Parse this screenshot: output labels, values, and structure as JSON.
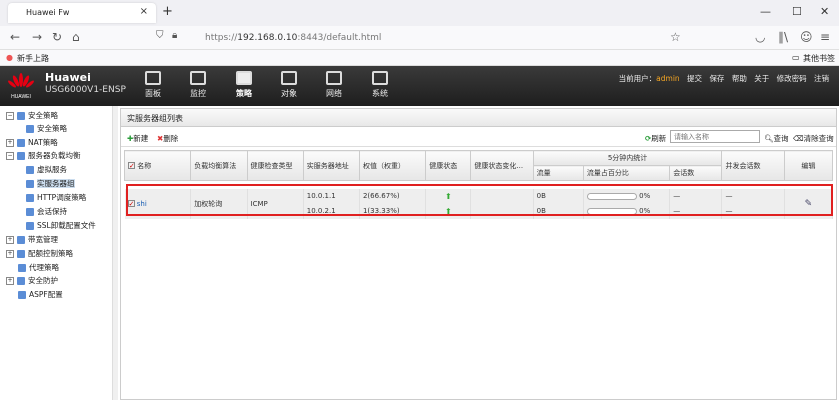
{
  "browser": {
    "tab_title": "Huawei Fw",
    "tab_close": "×",
    "new_tab": "+",
    "url_scheme": "https://",
    "url_host": "192.168.0.10",
    "url_rest": ":8443/default.html",
    "bookmark_1": "新手上路",
    "bookmark_other": "其他书签",
    "win_min": "—",
    "win_max": "☐",
    "win_close": "✕"
  },
  "app": {
    "brand": "Huawei",
    "model": "USG6000V1-ENSP",
    "logo_text": "HUAWEI",
    "modules": [
      {
        "label": "面板",
        "icon": "dashboard-icon"
      },
      {
        "label": "监控",
        "icon": "monitor-icon"
      },
      {
        "label": "策略",
        "icon": "policy-icon"
      },
      {
        "label": "对象",
        "icon": "object-icon"
      },
      {
        "label": "网络",
        "icon": "network-icon"
      },
      {
        "label": "系统",
        "icon": "system-icon"
      }
    ],
    "active_module": "策略",
    "top_links": {
      "user_label": "当前用户：",
      "user": "admin",
      "commit": "提交",
      "save": "保存",
      "help": "帮助",
      "about": "关于",
      "change_pwd": "修改密码",
      "logout": "注销"
    }
  },
  "sidebar": {
    "items": [
      {
        "label": "安全策略",
        "level": 0,
        "expander": "⊟"
      },
      {
        "label": "安全策略",
        "level": 1
      },
      {
        "label": "NAT策略",
        "level": 0,
        "expander": "⊞"
      },
      {
        "label": "服务器负载均衡",
        "level": 0,
        "expander": "⊟"
      },
      {
        "label": "虚拟服务",
        "level": 1
      },
      {
        "label": "实服务器组",
        "level": 1,
        "selected": true
      },
      {
        "label": "HTTP调度策略",
        "level": 1
      },
      {
        "label": "会话保持",
        "level": 1
      },
      {
        "label": "SSL卸载配置文件",
        "level": 1
      },
      {
        "label": "带宽管理",
        "level": 0,
        "expander": "⊞"
      },
      {
        "label": "配额控制策略",
        "level": 0,
        "expander": "⊞"
      },
      {
        "label": "代理策略",
        "level": 0
      },
      {
        "label": "安全防护",
        "level": 0,
        "expander": "⊞"
      },
      {
        "label": "ASPF配置",
        "level": 0
      }
    ]
  },
  "panel": {
    "title": "实服务器组列表",
    "new_btn": "新建",
    "delete_btn": "删除",
    "refresh_btn": "刷新",
    "search_placeholder": "请输入名称",
    "query_btn": "查询",
    "clear_btn": "清除查询"
  },
  "table": {
    "headers": {
      "name": "名称",
      "algorithm": "负载均衡算法",
      "health_type": "健康检查类型",
      "address": "实服务器地址",
      "weight": "权值（权重）",
      "health_state": "健康状态",
      "health_change": "健康状态变化...",
      "stats_5min": "5分钟内统计",
      "traffic": "流量",
      "traffic_ratio": "流量占百分比",
      "sessions": "会话数",
      "concurrent": "并发会话数",
      "edit": "编辑"
    },
    "rows": [
      {
        "name": "shi",
        "algorithm": "加权轮询",
        "health_type": "ICMP",
        "servers": [
          {
            "address": "10.0.1.1",
            "weight": "2(66.67%)",
            "traffic": "0B",
            "ratio_pct": "0%",
            "ratio": 0,
            "sessions": "—",
            "concurrent": "—"
          },
          {
            "address": "10.0.2.1",
            "weight": "1(33.33%)",
            "traffic": "0B",
            "ratio_pct": "0%",
            "ratio": 0,
            "sessions": "—",
            "concurrent": "—"
          }
        ]
      }
    ]
  },
  "colors": {
    "header_bg": "#2d2d2d",
    "highlight": "#e02020",
    "accent_user": "#f5a623"
  }
}
